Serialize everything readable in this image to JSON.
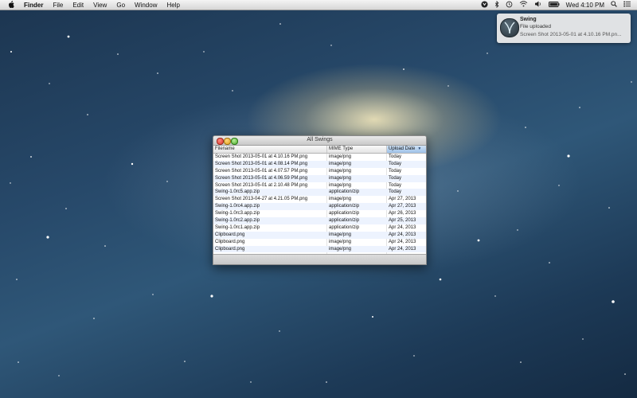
{
  "menubar": {
    "app_name": "Finder",
    "items": [
      "File",
      "Edit",
      "View",
      "Go",
      "Window",
      "Help"
    ],
    "clock": "Wed 4:10 PM"
  },
  "notification": {
    "title": "Swing",
    "subtitle": "File uploaded",
    "body": "Screen Shot 2013-05-01 at 4.10.16 PM.pn..."
  },
  "window": {
    "title": "All Swings",
    "columns": [
      "Filename",
      "MIME Type",
      "Upload Date"
    ],
    "sort_arrow": "▼",
    "rows": [
      [
        "Screen Shot 2013-05-01 at 4.10.16 PM.png",
        "image/png",
        "Today"
      ],
      [
        "Screen Shot 2013-05-01 at 4.08.14 PM.png",
        "image/png",
        "Today"
      ],
      [
        "Screen Shot 2013-05-01 at 4.07.57 PM.png",
        "image/png",
        "Today"
      ],
      [
        "Screen Shot 2013-05-01 at 4.06.59 PM.png",
        "image/png",
        "Today"
      ],
      [
        "Screen Shot 2013-05-01 at 2.10.48 PM.png",
        "image/png",
        "Today"
      ],
      [
        "Swing-1.0rc5.app.zip",
        "application/zip",
        "Today"
      ],
      [
        "Screen Shot 2013-04-27 at 4.21.05 PM.png",
        "image/png",
        "Apr 27, 2013"
      ],
      [
        "Swing-1.0rc4.app.zip",
        "application/zip",
        "Apr 27, 2013"
      ],
      [
        "Swing-1.0rc3.app.zip",
        "application/zip",
        "Apr 26, 2013"
      ],
      [
        "Swing-1.0rc2.app.zip",
        "application/zip",
        "Apr 25, 2013"
      ],
      [
        "Swing-1.0rc1.app.zip",
        "application/zip",
        "Apr 24, 2013"
      ],
      [
        "Clipboard.png",
        "image/png",
        "Apr 24, 2013"
      ],
      [
        "Clipboard.png",
        "image/png",
        "Apr 24, 2013"
      ],
      [
        "Clipboard.png",
        "image/png",
        "Apr 24, 2013"
      ]
    ]
  },
  "icons": {
    "apple": "apple-icon",
    "status": [
      "swing-status-icon",
      "bluetooth-icon",
      "time-machine-icon",
      "wifi-icon",
      "volume-icon",
      "battery-icon",
      "spotlight-icon",
      "notification-center-icon"
    ]
  },
  "colors": {
    "sorted_header": "#9fc2e8",
    "row_stripe": "#edf3fe",
    "close": "#d9382c",
    "minimize": "#e0a11a",
    "zoom": "#4aa92a"
  }
}
